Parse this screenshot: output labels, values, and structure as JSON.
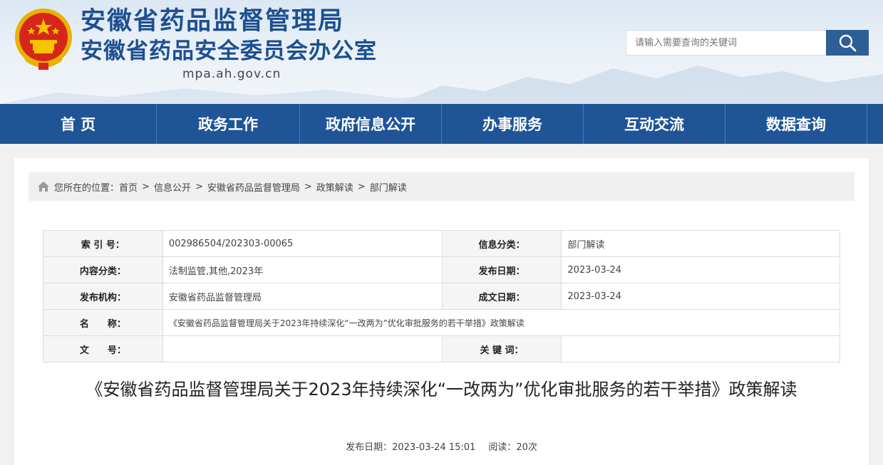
{
  "header": {
    "org_title": "安徽省药品监督管理局",
    "org_subtitle": "安徽省药品安全委员会办公室",
    "domain": "mpa.ah.gov.cn",
    "search_placeholder": "请输入需要查询的关键词"
  },
  "nav": {
    "items": [
      "首 页",
      "政务工作",
      "政府信息公开",
      "办事服务",
      "互动交流",
      "数据查询"
    ]
  },
  "breadcrumb": {
    "prefix": "您所在的位置：",
    "items": [
      "首页",
      "信息公开",
      "安徽省药品监督管理局",
      "政策解读",
      "部门解读"
    ],
    "separator": ">"
  },
  "meta": {
    "index_label": "索 引 号：",
    "index_value": "002986504/202303-00065",
    "info_cat_label": "信息分类：",
    "info_cat_value": "部门解读",
    "content_cat_label": "内容分类：",
    "content_cat_value": "法制监管,其他,2023年",
    "pub_date_label": "发布日期：",
    "pub_date_value": "2023-03-24",
    "publisher_label": "发布机构：",
    "publisher_value": "安徽省药品监督管理局",
    "made_date_label": "成文日期：",
    "made_date_value": "2023-03-24",
    "name_label": "名　　称：",
    "name_value": "《安徽省药品监督管理局关于2023年持续深化“一改两为”优化审批服务的若干举措》政策解读",
    "doc_no_label": "文　　号：",
    "doc_no_value": "",
    "keywords_label": "关 键 词：",
    "keywords_value": ""
  },
  "article": {
    "title": "《安徽省药品监督管理局关于2023年持续深化“一改两为”优化审批服务的若干举措》政策解读",
    "pub_label": "发布日期：",
    "pub_datetime": "2023-03-24 15:01",
    "read_label": "阅读：",
    "read_count": "20次"
  },
  "colors": {
    "nav_bg": "#1f5597",
    "title_blue": "#1d4f91",
    "search_btn": "#2d5e96"
  }
}
